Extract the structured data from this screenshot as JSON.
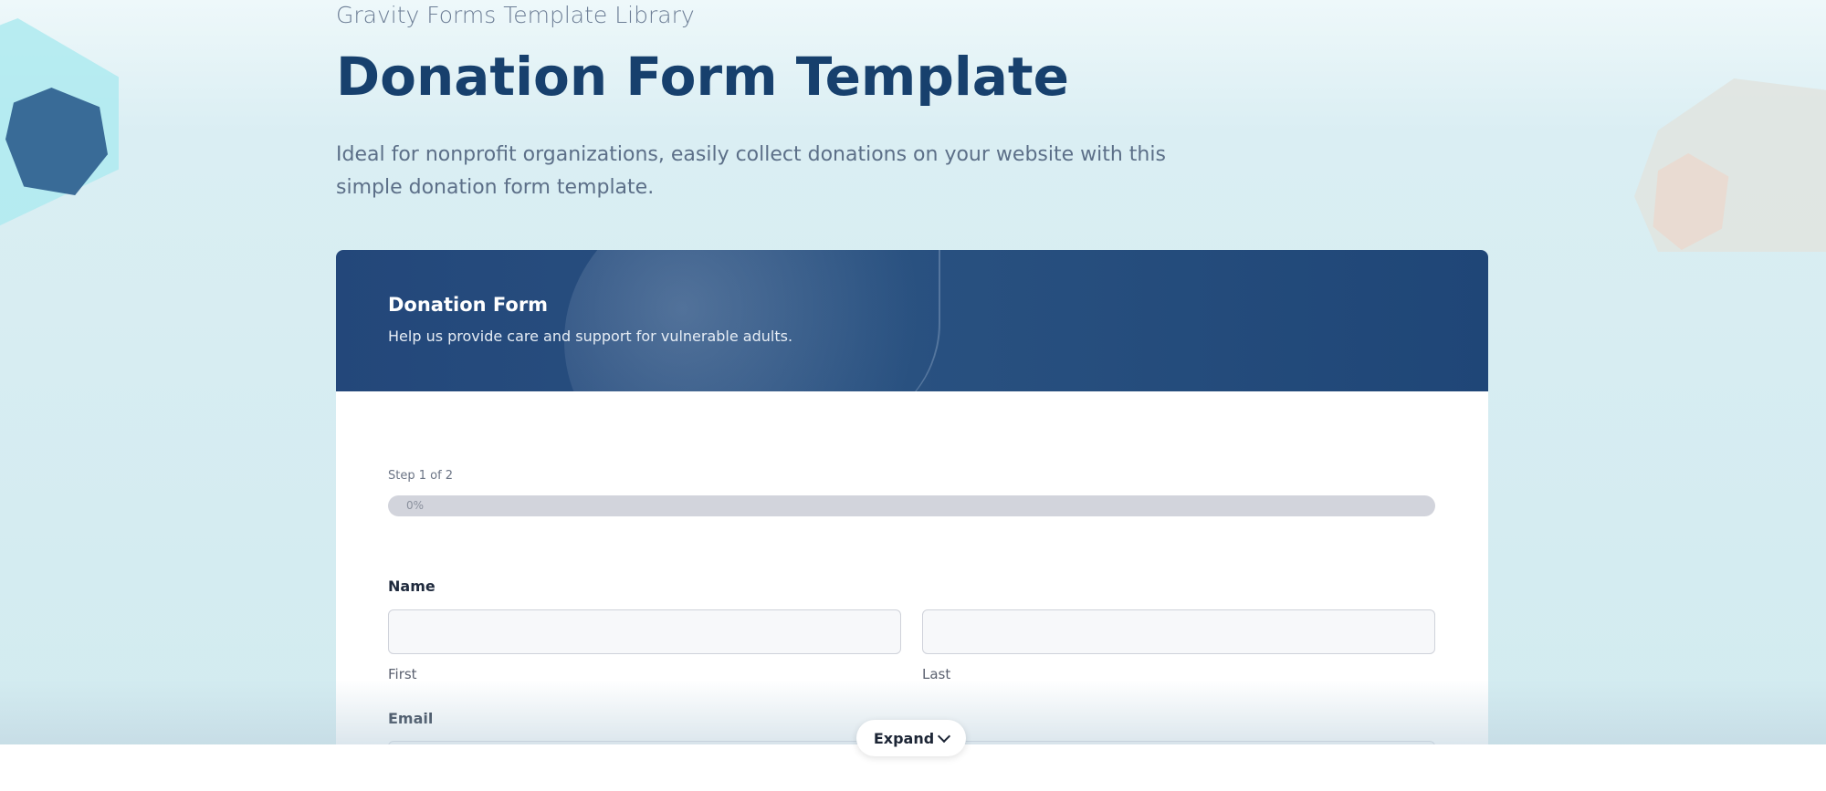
{
  "intro": {
    "library_label": "Gravity Forms Template Library",
    "title": "Donation Form Template",
    "description": "Ideal for nonprofit organizations, easily collect donations on your website with this simple donation form template."
  },
  "form": {
    "title": "Donation Form",
    "subtitle": "Help us provide care and support for vulnerable adults.",
    "step_text": "Step 1 of 2",
    "progress": {
      "value_percent": 0,
      "label": "0%"
    },
    "fields": {
      "name": {
        "label": "Name",
        "first": {
          "value": "",
          "sublabel": "First"
        },
        "last": {
          "value": "",
          "sublabel": "Last"
        }
      },
      "email": {
        "label": "Email",
        "value": ""
      }
    }
  },
  "expand_button": {
    "label": "Expand",
    "icon": "chevron-down-icon"
  },
  "colors": {
    "title_blue": "#17406d",
    "header_blue": "#23477a"
  }
}
